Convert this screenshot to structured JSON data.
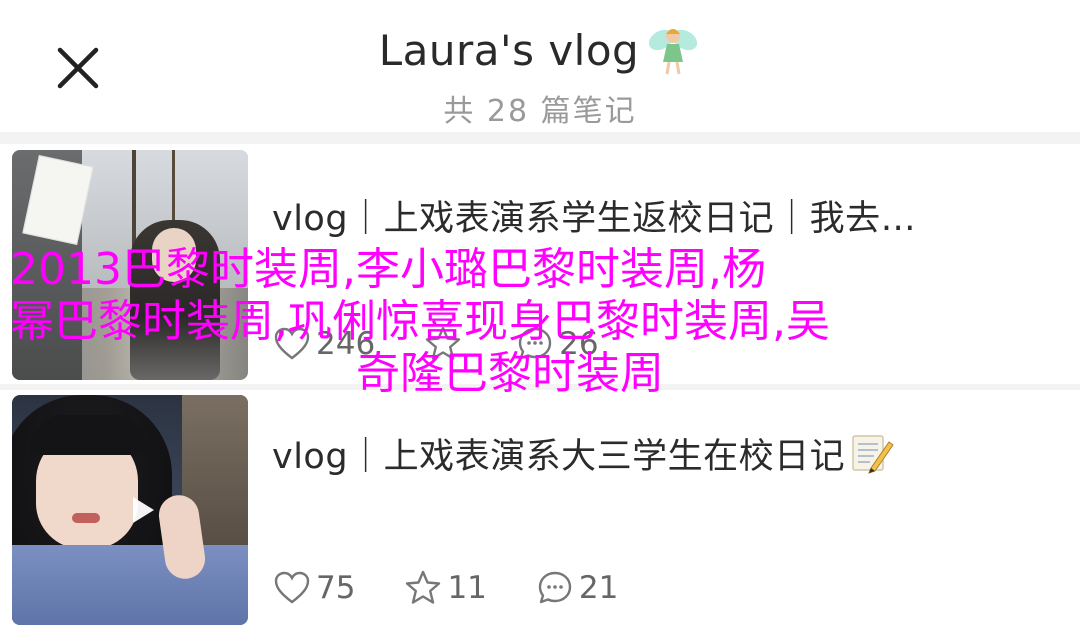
{
  "header": {
    "title": "Laura's vlog",
    "title_icon": "fairy-icon",
    "subtitle": "共 28 篇笔记",
    "close_icon": "close-icon"
  },
  "notes": [
    {
      "title": "vlog｜上戏表演系学生返校日记｜我去…",
      "thumbnail": "street-selfie-thumbnail",
      "likes": "246",
      "favorites": "",
      "comments": "26"
    },
    {
      "title": "vlog｜上戏表演系大三学生在校日记",
      "title_icon": "memo-icon",
      "thumbnail": "peace-sign-selfie-video-thumbnail",
      "likes": "75",
      "favorites": "11",
      "comments": "21"
    }
  ],
  "overlay": {
    "line1": "2013巴黎时装周,李小璐巴黎时装周,杨",
    "line2": "幂巴黎时装周,巩俐惊喜现身巴黎时装周,吴",
    "line3": "奇隆巴黎时装周",
    "color": "#ff00ff"
  },
  "colors": {
    "background": "#f3f3f3",
    "card": "#ffffff",
    "title_text": "#2a2a2a",
    "subtitle_text": "#9a9a9a",
    "stat_text": "#666666"
  }
}
